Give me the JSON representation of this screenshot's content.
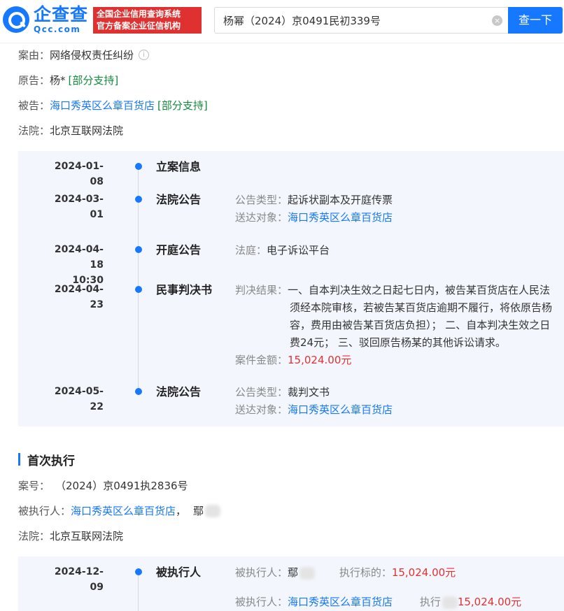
{
  "header": {
    "logo_cn": "企查查",
    "logo_en": "Qcc.com",
    "badge_line1": "全国企业信用查询系统",
    "badge_line2": "官方备案企业征信机构",
    "search_value": "杨幂（2024）京0491民初339号",
    "search_button": "查一下",
    "clear_icon": "×"
  },
  "case": {
    "cause_label": "案由：",
    "cause": "网络侵权责任纠纷",
    "plaintiff_label": "原告：",
    "plaintiff": "杨*",
    "plaintiff_tag": "[部分支持]",
    "defendant_label": "被告：",
    "defendant": "海口秀英区么章百货店",
    "defendant_tag": "[部分支持]",
    "court_label": "法院：",
    "court": "北京互联网法院"
  },
  "timeline": [
    {
      "date": "2024-01-08",
      "time": "",
      "title": "立案信息"
    },
    {
      "date": "2024-03-01",
      "time": "",
      "title": "法院公告",
      "l1_label": "公告类型：",
      "l1_value": "起诉状副本及开庭传票",
      "l2_label": "送达对象：",
      "l2_value": "海口秀英区么章百货店"
    },
    {
      "date": "2024-04-18",
      "time": "10:30",
      "title": "开庭公告",
      "l1_label": "法庭：",
      "l1_value": "电子诉讼平台"
    },
    {
      "date": "2024-04-23",
      "time": "",
      "title": "民事判决书",
      "l1_label": "判决结果：",
      "r1": "一、自本判决生效之日起七日内，被告某百货店在人民法",
      "r2": "须经本院审核，若被告某百货店逾期不履行，将依原告杨",
      "r3": "容，费用由被告某百货店负担）；  二、自本判决生效之日",
      "r4": "费24元；  三、驳回原告杨某的其他诉讼请求。",
      "amount_label": "案件金额：",
      "amount": "15,024.00元"
    },
    {
      "date": "2024-05-22",
      "time": "",
      "title": "法院公告",
      "l1_label": "公告类型：",
      "l1_value": "裁判文书",
      "l2_label": "送达对象：",
      "l2_value": "海口秀英区么章百货店"
    }
  ],
  "execution": {
    "section_title": "首次执行",
    "case_no_label": "案号：",
    "case_no": "（2024）京0491执2836号",
    "executed_label": "被执行人：",
    "executed_1": "海口秀英区么章百货店",
    "executed_sep": "，",
    "executed_2": "鄢",
    "court_label": "法院：",
    "court": "北京互联网法院",
    "item": {
      "date": "2024-12-09",
      "title": "被执行人",
      "p1_label": "被执行人：",
      "p1_value": "鄢",
      "target_label": "执行标的：",
      "target_value": "15,024.00元",
      "p2_label": "被执行人：",
      "p2_value": "海口秀英区么章百货店",
      "target2_label": "执行",
      "target2_value": "15,024.00元"
    }
  }
}
